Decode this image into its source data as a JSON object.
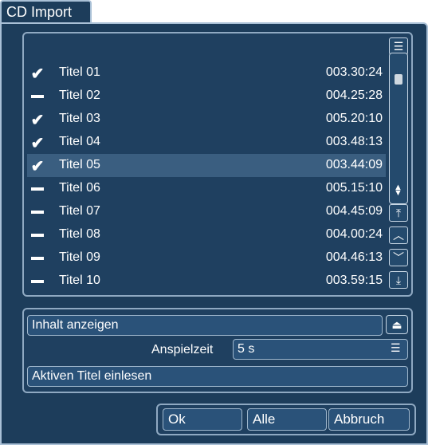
{
  "dialog": {
    "tab_label": "CD Import"
  },
  "tracks": [
    {
      "title": "Titel 01",
      "time": "003.30:24",
      "state": "check"
    },
    {
      "title": "Titel 02",
      "time": "004.25:28",
      "state": "dash"
    },
    {
      "title": "Titel 03",
      "time": "005.20:10",
      "state": "check"
    },
    {
      "title": "Titel 04",
      "time": "003.48:13",
      "state": "check"
    },
    {
      "title": "Titel 05",
      "time": "003.44:09",
      "state": "check",
      "selected": true
    },
    {
      "title": "Titel 06",
      "time": "005.15:10",
      "state": "dash"
    },
    {
      "title": "Titel 07",
      "time": "004.45:09",
      "state": "dash"
    },
    {
      "title": "Titel 08",
      "time": "004.00:24",
      "state": "dash"
    },
    {
      "title": "Titel 09",
      "time": "004.46:13",
      "state": "dash"
    },
    {
      "title": "Titel 10",
      "time": "003.59:15",
      "state": "dash"
    }
  ],
  "controls": {
    "show_content": "Inhalt anzeigen",
    "playtime_label": "Anspielzeit",
    "playtime_value": "5 s",
    "read_active": "Aktiven Titel einlesen"
  },
  "buttons": {
    "ok": "Ok",
    "all": "Alle",
    "cancel": "Abbruch"
  },
  "icons": {
    "list_menu": "list-icon",
    "scroll_top": "double-up-icon",
    "scroll_up": "chevron-up-icon",
    "scroll_down": "chevron-down-icon",
    "scroll_bottom": "double-down-icon",
    "eject": "eject-icon",
    "dropdown_menu": "menu-icon"
  },
  "colors": {
    "background": "#1d3d5b",
    "border": "#a9c0d6",
    "selected_row": "#3a5e80"
  }
}
